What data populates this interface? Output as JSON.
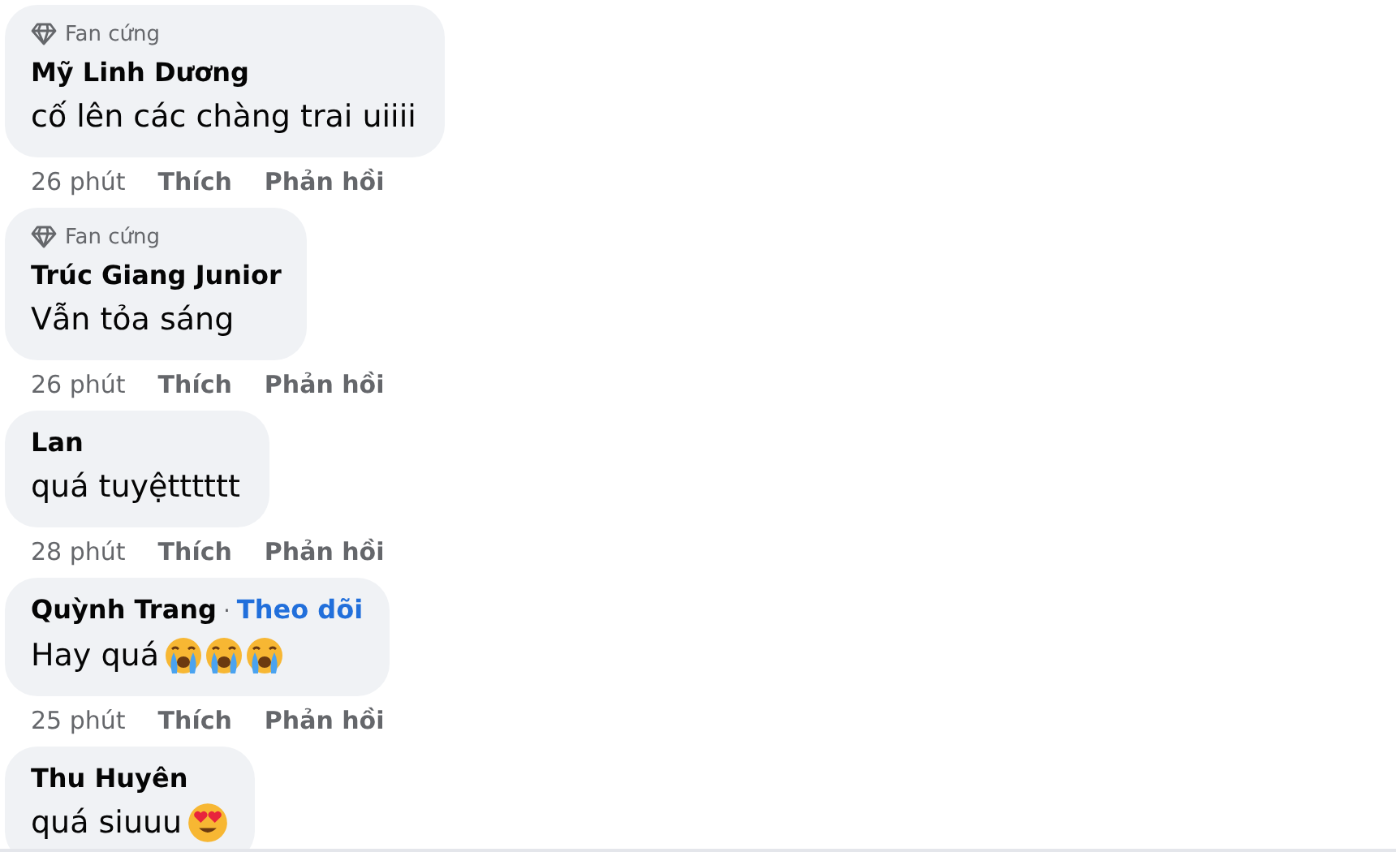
{
  "comments": [
    {
      "badge": "Fan cứng",
      "author": "Mỹ Linh Dương",
      "text": "cố lên các chàng trai uiiii",
      "time": "26 phút",
      "like": "Thích",
      "reply": "Phản hồi"
    },
    {
      "badge": "Fan cứng",
      "author": "Trúc Giang Junior",
      "text": "Vẫn tỏa sáng",
      "time": "26 phút",
      "like": "Thích",
      "reply": "Phản hồi"
    },
    {
      "author": "Lan",
      "text": "quá tuyệtttttt",
      "time": "28 phút",
      "like": "Thích",
      "reply": "Phản hồi"
    },
    {
      "author": "Quỳnh Trang",
      "separator": "·",
      "follow": "Theo dõi",
      "text": "Hay quá",
      "emojis": [
        {
          "kind": "crying"
        },
        {
          "kind": "crying"
        },
        {
          "kind": "crying"
        }
      ],
      "time": "25 phút",
      "like": "Thích",
      "reply": "Phản hồi"
    },
    {
      "author": "Thu Huyên",
      "text": "quá siuuu",
      "emojis": [
        {
          "kind": "heart-eyes"
        }
      ]
    }
  ]
}
